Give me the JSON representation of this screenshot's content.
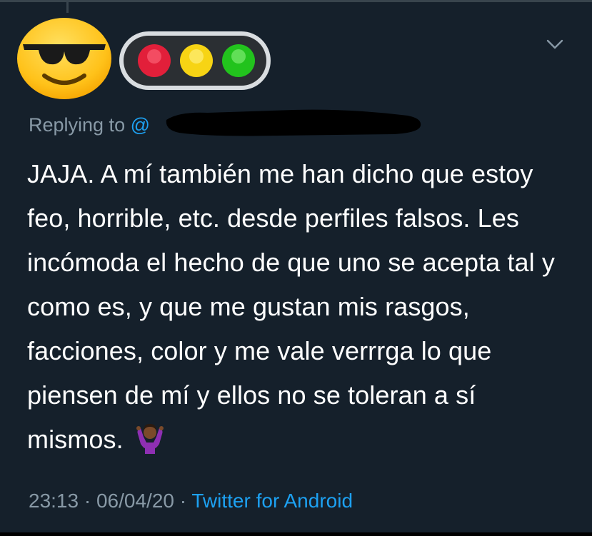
{
  "tweet": {
    "replying_prefix": "Replying to ",
    "replying_handle": "@",
    "text": "JAJA. A mí también me han dicho que estoy feo, horrible, etc. desde perfiles falsos. Les incómoda el hecho de que uno se acepta tal y como es, y que me gustan mis rasgos, facciones, color y me vale verrrga lo que piensen de mí y ellos no se toleran a sí mismos.",
    "time": "23:13",
    "separator": " · ",
    "date": "06/04/20",
    "source": "Twitter for Android"
  },
  "icons": {
    "avatar": "sunglasses-face-emoji",
    "name_emoji": "traffic-light-emoji",
    "menu": "chevron-down-icon",
    "inline_emoji": "person-shrugging-emoji"
  },
  "colors": {
    "background": "#15202b",
    "text": "#ffffff",
    "secondary": "#8899a6",
    "accent": "#1da1f2"
  }
}
